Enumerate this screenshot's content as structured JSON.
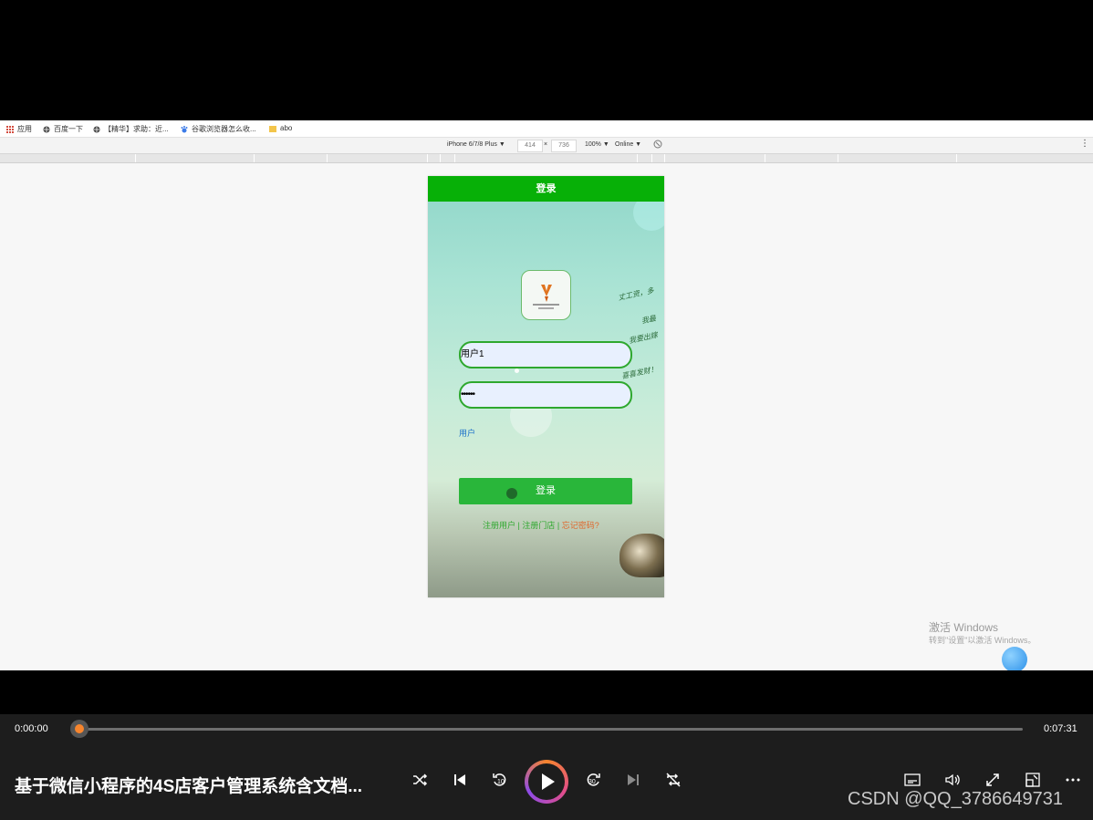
{
  "bookmarks": {
    "items": [
      {
        "label": "应用",
        "icon": "apps-grid-icon"
      },
      {
        "label": "百度一下",
        "icon": "globe-icon"
      },
      {
        "label": "【精华】求助：近...",
        "icon": "globe-icon"
      },
      {
        "label": "谷歌浏览器怎么收...",
        "icon": "paw-icon"
      },
      {
        "label": "abo",
        "icon": "folder-icon"
      }
    ]
  },
  "devtools": {
    "device": "iPhone 6/7/8 Plus ▼",
    "width": "414",
    "times": "×",
    "height": "736",
    "zoom": "100% ▼",
    "network": "Online ▼",
    "more": "⋮"
  },
  "app": {
    "nav_title": "登录",
    "username_value": "用户1",
    "password_value": "••••••",
    "role_label": "用户",
    "login_button": "登录",
    "register_user": "注册用户",
    "separator1": "|",
    "register_store": "注册门店",
    "separator2": "|",
    "forgot_password": "忘记密码?",
    "colors": {
      "nav": "#07b007",
      "button": "#29b63a",
      "link_green": "#2ea82e",
      "link_orange": "#e0662a"
    }
  },
  "windows_activation": {
    "line1": "激活 Windows",
    "line2": "转到\"设置\"以激活 Windows。"
  },
  "player": {
    "current_time": "0:00:00",
    "duration": "0:07:31",
    "progress": 0,
    "title": "基于微信小程序的4S店客户管理系统含文档...",
    "watermark": "CSDN @QQ_3786649731"
  }
}
